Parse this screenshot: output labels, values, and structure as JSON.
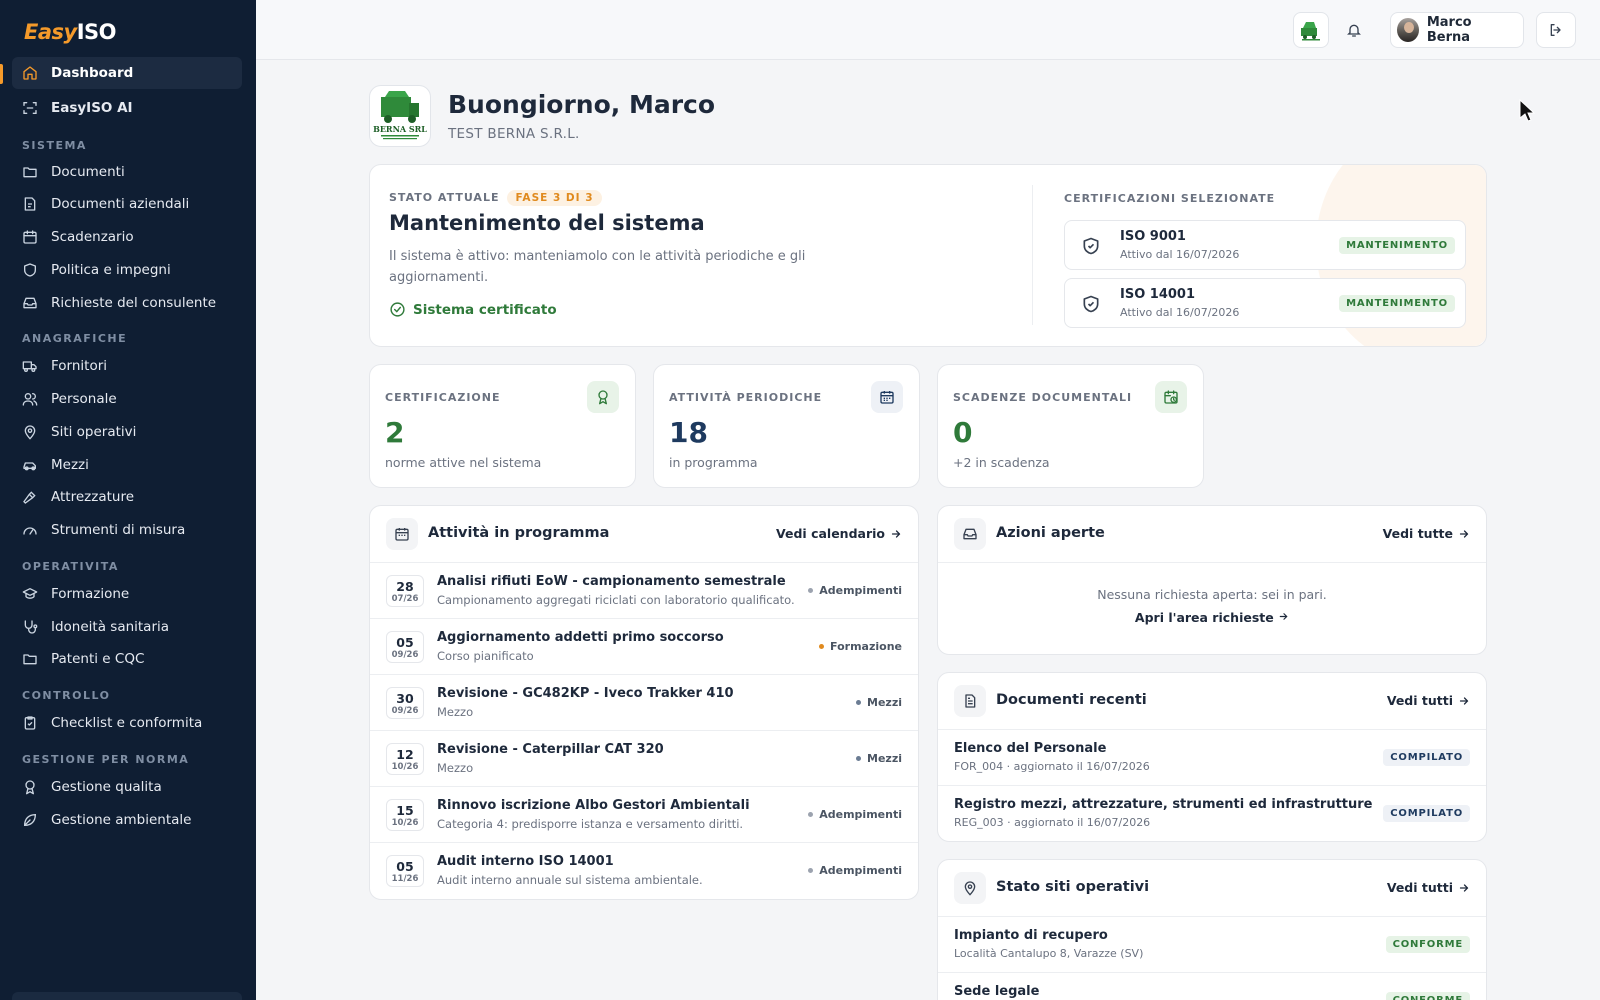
{
  "app": {
    "logo_prefix": "Easy",
    "logo_suffix": "ISO"
  },
  "sidebar": {
    "top_items": [
      {
        "label": "Dashboard",
        "icon": "home-icon"
      },
      {
        "label": "EasyISO AI",
        "icon": "scan-icon"
      }
    ],
    "sections": [
      {
        "title": "SISTEMA",
        "items": [
          "Documenti",
          "Documenti aziendali",
          "Scadenzario",
          "Politica e impegni",
          "Richieste del consulente"
        ]
      },
      {
        "title": "ANAGRAFICHE",
        "items": [
          "Fornitori",
          "Personale",
          "Siti operativi",
          "Mezzi",
          "Attrezzature",
          "Strumenti di misura"
        ]
      },
      {
        "title": "OPERATIVITA",
        "items": [
          "Formazione",
          "Idoneità sanitaria",
          "Patenti e CQC"
        ]
      },
      {
        "title": "CONTROLLO",
        "items": [
          "Checklist e conformita"
        ]
      },
      {
        "title": "GESTIONE PER NORMA",
        "items": [
          "Gestione qualita",
          "Gestione ambientale"
        ]
      }
    ]
  },
  "topbar": {
    "user_name": "Marco Berna"
  },
  "header": {
    "greeting": "Buongiorno, Marco",
    "company": "TEST BERNA S.R.L.",
    "logo_text": "BERNA SRL"
  },
  "status": {
    "label": "STATO ATTUALE",
    "phase": "FASE 3 DI 3",
    "title": "Mantenimento del sistema",
    "description": "Il sistema è attivo: manteniamolo con le attività periodiche e gli aggiornamenti.",
    "ok_label": "Sistema certificato",
    "certs_heading": "CERTIFICAZIONI SELEZIONATE",
    "certs": [
      {
        "name": "ISO 9001",
        "since": "Attivo dal 16/07/2026",
        "badge": "MANTENIMENTO"
      },
      {
        "name": "ISO 14001",
        "since": "Attivo dal 16/07/2026",
        "badge": "MANTENIMENTO"
      }
    ]
  },
  "stats": [
    {
      "label": "CERTIFICAZIONE",
      "value": "2",
      "sub": "norme attive nel sistema",
      "icon": "award-icon",
      "color": "#2f7a3a"
    },
    {
      "label": "ATTIVITÀ PERIODICHE",
      "value": "18",
      "sub": "in programma",
      "icon": "calendar-icon",
      "color": "#1e3a5f"
    },
    {
      "label": "SCADENZE DOCUMENTALI",
      "value": "0",
      "sub": "+2 in scadenza",
      "icon": "calendar-clock-icon",
      "color": "#2f7a3a"
    }
  ],
  "activities": {
    "title": "Attività in programma",
    "link": "Vedi calendario",
    "items": [
      {
        "day": "28",
        "month": "07/26",
        "title": "Analisi rifiuti EoW - campionamento semestrale",
        "sub": "Campionamento aggregati riciclati con laboratorio qualificato.",
        "tag": "Adempimenti",
        "dot": "#9ca3af"
      },
      {
        "day": "05",
        "month": "09/26",
        "title": "Aggiornamento addetti primo soccorso",
        "sub": "Corso pianificato",
        "tag": "Formazione",
        "dot": "#e08a1e"
      },
      {
        "day": "30",
        "month": "09/26",
        "title": "Revisione - GC482KP - Iveco Trakker 410",
        "sub": "Mezzo",
        "tag": "Mezzi",
        "dot": "#6b7c93"
      },
      {
        "day": "12",
        "month": "10/26",
        "title": "Revisione - Caterpillar CAT 320",
        "sub": "Mezzo",
        "tag": "Mezzi",
        "dot": "#6b7c93"
      },
      {
        "day": "15",
        "month": "10/26",
        "title": "Rinnovo iscrizione Albo Gestori Ambientali",
        "sub": "Categoria 4: predisporre istanza e versamento diritti.",
        "tag": "Adempimenti",
        "dot": "#9ca3af"
      },
      {
        "day": "05",
        "month": "11/26",
        "title": "Audit interno ISO 14001",
        "sub": "Audit interno annuale sul sistema ambientale.",
        "tag": "Adempimenti",
        "dot": "#9ca3af"
      }
    ]
  },
  "actions": {
    "title": "Azioni aperte",
    "link": "Vedi tutte",
    "empty": "Nessuna richiesta aperta: sei in pari.",
    "empty_link": "Apri l'area richieste"
  },
  "documents": {
    "title": "Documenti recenti",
    "link": "Vedi tutti",
    "items": [
      {
        "title": "Elenco del Personale",
        "sub": "FOR_004 · aggiornato il 16/07/2026",
        "badge": "COMPILATO"
      },
      {
        "title": "Registro mezzi, attrezzature, strumenti ed infrastrutture",
        "sub": "REG_003 · aggiornato il 16/07/2026",
        "badge": "COMPILATO"
      }
    ]
  },
  "sites": {
    "title": "Stato siti operativi",
    "link": "Vedi tutti",
    "items": [
      {
        "title": "Impianto di recupero",
        "sub": "Località Cantalupo 8, Varazze (SV)",
        "badge": "CONFORME"
      },
      {
        "title": "Sede legale",
        "sub": "",
        "badge": "CONFORME"
      }
    ]
  }
}
